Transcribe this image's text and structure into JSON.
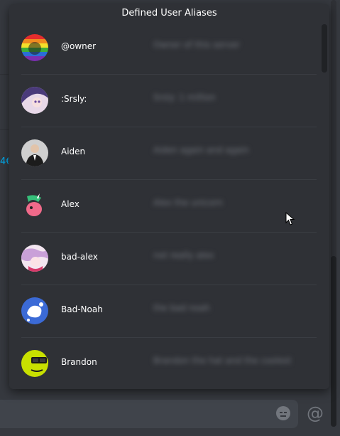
{
  "popup": {
    "title": "Defined User Aliases",
    "aliases": [
      {
        "name": "@owner",
        "value": "Owner of this server",
        "avatar": "rainbow-avatar"
      },
      {
        "name": ":Srsly:",
        "value": "Srsly: 1 million",
        "avatar": "anime-purple-avatar"
      },
      {
        "name": "Aiden",
        "value": "Aiden again and again",
        "avatar": "suit-person-avatar"
      },
      {
        "name": "Alex",
        "value": "Alex the unicorn",
        "avatar": "pony-avatar"
      },
      {
        "name": "bad-alex",
        "value": "not really alex",
        "avatar": "anime-pink-avatar"
      },
      {
        "name": "Bad-Noah",
        "value": "the bad noah",
        "avatar": "blue-splash-avatar"
      },
      {
        "name": "Brandon",
        "value": "Brandon the hat and the coolest",
        "avatar": "yellow-face-avatar"
      }
    ]
  },
  "background": {
    "partial_link": "4€"
  },
  "composer": {
    "emoji_icon": "emoji-icon",
    "mention_symbol": "@"
  },
  "colors": {
    "popup_bg": "#2f3136",
    "chat_bg": "#36393f",
    "link": "#00b0f4",
    "text": "#ffffff"
  }
}
